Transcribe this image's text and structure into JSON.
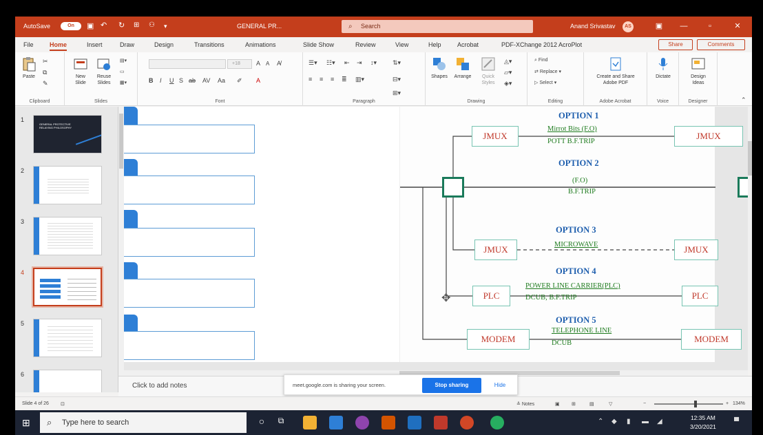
{
  "titlebar": {
    "autosave_label": "AutoSave",
    "autosave_state": "On",
    "doc_name": "GENERAL PR...",
    "search_placeholder": "Search",
    "user_name": "Anand Srivastav",
    "user_initials": "AS",
    "accent": "#c43e1c"
  },
  "ribbon_tabs": [
    "File",
    "Home",
    "Insert",
    "Draw",
    "Design",
    "Transitions",
    "Animations",
    "Slide Show",
    "Review",
    "View",
    "Help",
    "Acrobat",
    "PDF-XChange 2012 AcroPlot"
  ],
  "active_tab": "Home",
  "share_label": "Share",
  "comments_label": "Comments",
  "ribbon": {
    "clipboard": {
      "paste": "Paste",
      "label": "Clipboard"
    },
    "slides": {
      "new_slide": "New Slide",
      "reuse_slides": "Reuse Slides",
      "label": "Slides"
    },
    "font": {
      "label": "Font",
      "size": "+18"
    },
    "paragraph": {
      "label": "Paragraph"
    },
    "drawing": {
      "shapes": "Shapes",
      "arrange": "Arrange",
      "quick_styles": "Quick Styles",
      "label": "Drawing"
    },
    "editing": {
      "find": "Find",
      "replace": "Replace",
      "select": "Select",
      "label": "Editing"
    },
    "acrobat": {
      "create_share": "Create and Share Adobe PDF",
      "label": "Adobe Acrobat"
    },
    "voice": {
      "dictate": "Dictate",
      "label": "Voice"
    },
    "designer": {
      "design_ideas": "Design Ideas",
      "label": "Designer"
    }
  },
  "thumbnails": [
    {
      "num": "1",
      "title": "GENERAL PROTECTIVE RELAYING PHILOSOPHY"
    },
    {
      "num": "2"
    },
    {
      "num": "3"
    },
    {
      "num": "4",
      "selected": true
    },
    {
      "num": "5"
    },
    {
      "num": "6"
    }
  ],
  "diagram": {
    "options": [
      {
        "title": "OPTION 1",
        "left_box": "JMUX",
        "right_box": "JMUX",
        "labels": [
          "Mirrot Bits (F.O)",
          "POTT B.F.TRIP"
        ]
      },
      {
        "title": "OPTION 2",
        "labels": [
          "(F.O)",
          "B.F.TRIP"
        ]
      },
      {
        "title": "OPTION 3",
        "left_box": "JMUX",
        "right_box": "JMUX",
        "labels": [
          "MICROWAVE"
        ]
      },
      {
        "title": "OPTION 4",
        "left_box": "PLC",
        "right_box": "PLC",
        "labels": [
          "POWER LINE CARRIER(PLC)",
          "DCUB, B.F.TRIP"
        ]
      },
      {
        "title": "OPTION 5",
        "left_box": "MODEM",
        "right_box": "MODEM",
        "labels": [
          "TELEPHONE LINE",
          "DCUB"
        ]
      }
    ]
  },
  "notes_placeholder": "Click to add notes",
  "sharing_bar": {
    "message": "meet.google.com is sharing your screen.",
    "stop": "Stop sharing",
    "hide": "Hide"
  },
  "statusbar": {
    "slide_info": "Slide 4 of 26",
    "notes": "Notes",
    "zoom": "134%",
    "zoom_fraction": 0.6
  },
  "taskbar": {
    "search_placeholder": "Type here to search",
    "time": "12:35 AM",
    "date": "3/20/2021"
  }
}
